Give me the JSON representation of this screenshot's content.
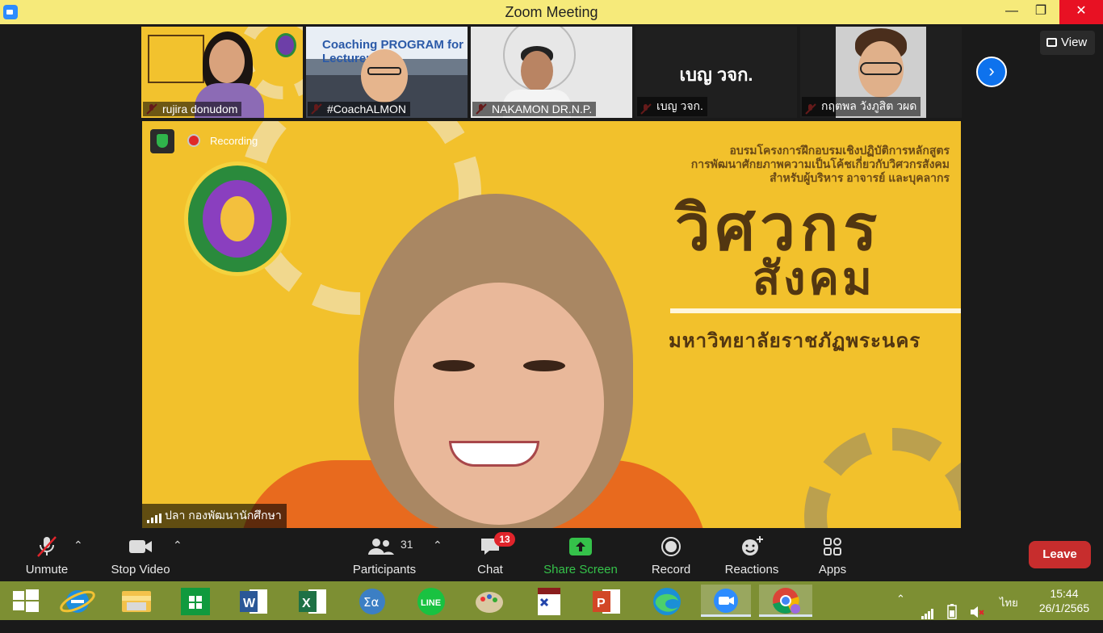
{
  "window": {
    "title": "Zoom Meeting",
    "minimize": "—",
    "maximize": "❐",
    "close": "✕"
  },
  "thumbnails": [
    {
      "name": "rujira donudom",
      "overlay": ""
    },
    {
      "name": "#CoachALMON",
      "overlay": "Coaching PROGRAM for Lecturer"
    },
    {
      "name": "NAKAMON DR.N.P.",
      "overlay": ""
    },
    {
      "name": "เบญ วจก.",
      "overlay": "เบญ วจก."
    },
    {
      "name": "กฤตพล วังภูสิต วผด",
      "overlay": ""
    }
  ],
  "view_button": {
    "label": "View"
  },
  "main_video": {
    "recording_label": "Recording",
    "speaker_name": "ปลา กองพัฒนานักศึกษา",
    "banner": {
      "line1": "อบรมโครงการฝึกอบรมเชิงปฏิบัติการหลักสูตร",
      "line2": "การพัฒนาศักยภาพความเป็นโค้ชเกี่ยวกับวิศวกรสังคม",
      "line3": "สำหรับผู้บริหาร อาจารย์ และบุคลากร",
      "big1": "วิศวกร",
      "big2": "สังคม",
      "university": "มหาวิทยาลัยราชภัฏพระนคร"
    }
  },
  "toolbar": {
    "unmute": "Unmute",
    "stop_video": "Stop Video",
    "participants": "Participants",
    "participants_count": "31",
    "chat": "Chat",
    "chat_badge": "13",
    "share_screen": "Share Screen",
    "record": "Record",
    "reactions": "Reactions",
    "apps": "Apps",
    "leave": "Leave"
  },
  "taskbar": {
    "apps": [
      "windows-start",
      "internet-explorer",
      "file-explorer",
      "store",
      "word",
      "excel",
      "calculator",
      "line",
      "paint",
      "lisrel",
      "powerpoint",
      "edge",
      "zoom",
      "chrome"
    ],
    "language": "ไทย",
    "time": "15:44",
    "date": "26/1/2565"
  },
  "colors": {
    "title_bar": "#f6ea7a",
    "share_green": "#35c24a",
    "leave_red": "#c72d2d",
    "taskbar": "#7d8f33",
    "badge_red": "#e0242b"
  }
}
